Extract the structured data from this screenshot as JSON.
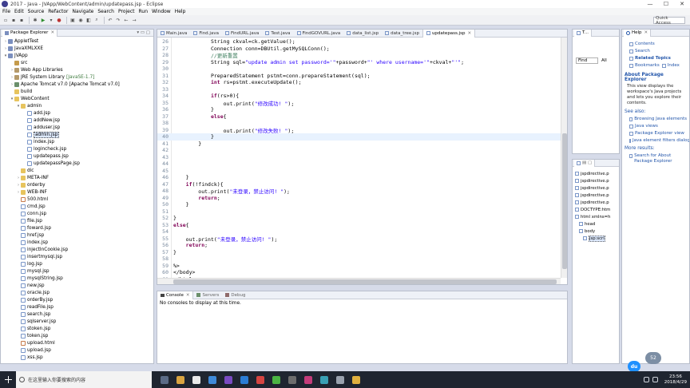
{
  "window": {
    "title": "2017 - Java - JVApp/WebContent/admin/updatepass.jsp - Eclipse",
    "controls": [
      "—",
      "☐",
      "✕"
    ]
  },
  "menu": [
    "File",
    "Edit",
    "Source",
    "Refactor",
    "Navigate",
    "Search",
    "Project",
    "Run",
    "Window",
    "Help"
  ],
  "toolbar": {
    "quick_access": "Quick Access"
  },
  "package_explorer": {
    "tab_label": "Package Explorer",
    "items": [
      {
        "label": "AppletTest",
        "indent": 0,
        "twisty": ">",
        "icon": "proj"
      },
      {
        "label": "JavaXMLXXE",
        "indent": 0,
        "twisty": ">",
        "icon": "proj"
      },
      {
        "label": "JVApp",
        "indent": 0,
        "twisty": "v",
        "icon": "proj"
      },
      {
        "label": "src",
        "indent": 1,
        "twisty": "",
        "icon": "pkg"
      },
      {
        "label": "Web App Libraries",
        "indent": 1,
        "twisty": ">",
        "icon": "lib"
      },
      {
        "label": "JRE System Library",
        "suffix": "[JavaSE-1.7]",
        "indent": 1,
        "twisty": ">",
        "icon": "lib"
      },
      {
        "label": "Apache Tomcat v7.0 [Apache Tomcat v7.0]",
        "indent": 1,
        "twisty": ">",
        "icon": "server"
      },
      {
        "label": "build",
        "indent": 1,
        "twisty": "",
        "icon": "folder"
      },
      {
        "label": "WebContent",
        "indent": 1,
        "twisty": "v",
        "icon": "folder"
      },
      {
        "label": "admin",
        "indent": 2,
        "twisty": "v",
        "icon": "folder"
      },
      {
        "label": "add.jsp",
        "indent": 3,
        "twisty": "",
        "icon": "jsp"
      },
      {
        "label": "addNew.jsp",
        "indent": 3,
        "twisty": "",
        "icon": "jsp"
      },
      {
        "label": "adduser.jsp",
        "indent": 3,
        "twisty": "",
        "icon": "jsp"
      },
      {
        "label": "admin.jsp",
        "indent": 3,
        "twisty": "",
        "icon": "jsp",
        "selected": true
      },
      {
        "label": "index.jsp",
        "indent": 3,
        "twisty": "",
        "icon": "jsp"
      },
      {
        "label": "logincheck.jsp",
        "indent": 3,
        "twisty": "",
        "icon": "jsp"
      },
      {
        "label": "updatepass.jsp",
        "indent": 3,
        "twisty": "",
        "icon": "jsp"
      },
      {
        "label": "updatepassPage.jsp",
        "indent": 3,
        "twisty": "",
        "icon": "jsp"
      },
      {
        "label": "dic",
        "indent": 2,
        "twisty": "",
        "icon": "folder"
      },
      {
        "label": "META-INF",
        "indent": 2,
        "twisty": ">",
        "icon": "folder"
      },
      {
        "label": "orderby",
        "indent": 2,
        "twisty": ">",
        "icon": "folder"
      },
      {
        "label": "WEB-INF",
        "indent": 2,
        "twisty": ">",
        "icon": "folder"
      },
      {
        "label": "500.html",
        "indent": 2,
        "twisty": "",
        "icon": "html"
      },
      {
        "label": "cmd.jsp",
        "indent": 2,
        "twisty": "",
        "icon": "jsp"
      },
      {
        "label": "conn.jsp",
        "indent": 2,
        "twisty": "",
        "icon": "jsp"
      },
      {
        "label": "file.jsp",
        "indent": 2,
        "twisty": "",
        "icon": "jsp"
      },
      {
        "label": "foward.jsp",
        "indent": 2,
        "twisty": "",
        "icon": "jsp"
      },
      {
        "label": "href.jsp",
        "indent": 2,
        "twisty": "",
        "icon": "jsp"
      },
      {
        "label": "index.jsp",
        "indent": 2,
        "twisty": "",
        "icon": "jsp"
      },
      {
        "label": "injectInCookie.jsp",
        "indent": 2,
        "twisty": "",
        "icon": "jsp"
      },
      {
        "label": "insertmysql.jsp",
        "indent": 2,
        "twisty": "",
        "icon": "jsp"
      },
      {
        "label": "log.jsp",
        "indent": 2,
        "twisty": "",
        "icon": "jsp"
      },
      {
        "label": "mysql.jsp",
        "indent": 2,
        "twisty": "",
        "icon": "jsp"
      },
      {
        "label": "mysqlString.jsp",
        "indent": 2,
        "twisty": "",
        "icon": "jsp"
      },
      {
        "label": "new.jsp",
        "indent": 2,
        "twisty": "",
        "icon": "jsp"
      },
      {
        "label": "oracle.jsp",
        "indent": 2,
        "twisty": "",
        "icon": "jsp"
      },
      {
        "label": "orderBy.jsp",
        "indent": 2,
        "twisty": "",
        "icon": "jsp"
      },
      {
        "label": "readFile.jsp",
        "indent": 2,
        "twisty": "",
        "icon": "jsp"
      },
      {
        "label": "search.jsp",
        "indent": 2,
        "twisty": "",
        "icon": "jsp"
      },
      {
        "label": "sqlserver.jsp",
        "indent": 2,
        "twisty": "",
        "icon": "jsp"
      },
      {
        "label": "stoken.jsp",
        "indent": 2,
        "twisty": "",
        "icon": "jsp"
      },
      {
        "label": "token.jsp",
        "indent": 2,
        "twisty": "",
        "icon": "jsp"
      },
      {
        "label": "upload.html",
        "indent": 2,
        "twisty": "",
        "icon": "html"
      },
      {
        "label": "upload.jsp",
        "indent": 2,
        "twisty": "",
        "icon": "jsp"
      },
      {
        "label": "xss.jsp",
        "indent": 2,
        "twisty": "",
        "icon": "jsp"
      }
    ]
  },
  "editor": {
    "tabs": [
      {
        "label": "Main.java",
        "active": false
      },
      {
        "label": "Find.java",
        "active": false
      },
      {
        "label": "FindURL.java",
        "active": false
      },
      {
        "label": "Test.java",
        "active": false
      },
      {
        "label": "FindGOVURL.java",
        "active": false
      },
      {
        "label": "data_list.jsp",
        "active": false
      },
      {
        "label": "data_tree.jsp",
        "active": false
      },
      {
        "label": "updatepass.jsp",
        "active": true
      }
    ],
    "current_line": 40,
    "lines": [
      {
        "n": "26",
        "segs": [
          {
            "t": "            String ckval=ck.getValue();"
          }
        ]
      },
      {
        "n": "27",
        "segs": [
          {
            "t": "            Connection conn=DBUtil.getMySQLConn();"
          }
        ]
      },
      {
        "n": "28",
        "segs": [
          {
            "t": "            //更新重置",
            "c": "cmt"
          }
        ]
      },
      {
        "n": "29",
        "segs": [
          {
            "t": "            String sql="
          },
          {
            "t": "\"update admin set password='\"",
            "c": "str"
          },
          {
            "t": "+password+"
          },
          {
            "t": "\"' where username='\"",
            "c": "str"
          },
          {
            "t": "+ckval+"
          },
          {
            "t": "\"'\"",
            "c": "str"
          },
          {
            "t": ";"
          }
        ]
      },
      {
        "n": "30",
        "segs": [
          {
            "t": ""
          }
        ]
      },
      {
        "n": "31",
        "segs": [
          {
            "t": "            PreparedStatement pstmt=conn.prepareStatement(sql);"
          }
        ]
      },
      {
        "n": "32",
        "segs": [
          {
            "t": "            "
          },
          {
            "t": "int",
            "c": "kw"
          },
          {
            "t": " rs=pstmt.executeUpdate();"
          }
        ]
      },
      {
        "n": "33",
        "segs": [
          {
            "t": ""
          }
        ]
      },
      {
        "n": "34",
        "segs": [
          {
            "t": "            "
          },
          {
            "t": "if",
            "c": "kw"
          },
          {
            "t": "(rs>0){"
          }
        ]
      },
      {
        "n": "35",
        "segs": [
          {
            "t": "                out.print("
          },
          {
            "t": "\"修改成功! \"",
            "c": "str"
          },
          {
            "t": ");"
          }
        ]
      },
      {
        "n": "36",
        "segs": [
          {
            "t": "            }"
          }
        ]
      },
      {
        "n": "37",
        "segs": [
          {
            "t": "            "
          },
          {
            "t": "else",
            "c": "kw"
          },
          {
            "t": "{"
          }
        ]
      },
      {
        "n": "38",
        "segs": [
          {
            "t": ""
          }
        ]
      },
      {
        "n": "39",
        "segs": [
          {
            "t": "                out.print("
          },
          {
            "t": "\"修改失败! \"",
            "c": "str"
          },
          {
            "t": ");"
          }
        ]
      },
      {
        "n": "40",
        "segs": [
          {
            "t": "            }"
          }
        ]
      },
      {
        "n": "41",
        "segs": [
          {
            "t": "        }"
          }
        ]
      },
      {
        "n": "42",
        "segs": [
          {
            "t": ""
          }
        ]
      },
      {
        "n": "43",
        "segs": [
          {
            "t": ""
          }
        ]
      },
      {
        "n": "44",
        "segs": [
          {
            "t": ""
          }
        ]
      },
      {
        "n": "45",
        "segs": [
          {
            "t": ""
          }
        ]
      },
      {
        "n": "46",
        "segs": [
          {
            "t": "    }"
          }
        ]
      },
      {
        "n": "47",
        "segs": [
          {
            "t": "    "
          },
          {
            "t": "if",
            "c": "kw"
          },
          {
            "t": "(!findck){"
          }
        ]
      },
      {
        "n": "48",
        "segs": [
          {
            "t": "        out.print("
          },
          {
            "t": "\"未登录，禁止访问! \"",
            "c": "str"
          },
          {
            "t": ");"
          }
        ]
      },
      {
        "n": "49",
        "segs": [
          {
            "t": "        "
          },
          {
            "t": "return",
            "c": "kw"
          },
          {
            "t": ";"
          }
        ]
      },
      {
        "n": "50",
        "segs": [
          {
            "t": "    }"
          }
        ]
      },
      {
        "n": "51",
        "segs": [
          {
            "t": ""
          }
        ]
      },
      {
        "n": "52",
        "segs": [
          {
            "t": "}"
          }
        ]
      },
      {
        "n": "53",
        "segs": [
          {
            "t": ""
          },
          {
            "t": "else",
            "c": "kw"
          },
          {
            "t": "{"
          }
        ]
      },
      {
        "n": "54",
        "segs": [
          {
            "t": ""
          }
        ]
      },
      {
        "n": "55",
        "segs": [
          {
            "t": "    out.print("
          },
          {
            "t": "\"未登录，禁止访问! \"",
            "c": "str"
          },
          {
            "t": ");"
          }
        ]
      },
      {
        "n": "56",
        "segs": [
          {
            "t": "    "
          },
          {
            "t": "return",
            "c": "kw"
          },
          {
            "t": ";"
          }
        ]
      },
      {
        "n": "57",
        "segs": [
          {
            "t": "}"
          }
        ]
      },
      {
        "n": "58",
        "segs": [
          {
            "t": ""
          }
        ]
      },
      {
        "n": "59",
        "segs": [
          {
            "t": "%>"
          }
        ]
      },
      {
        "n": "60",
        "segs": [
          {
            "t": "</body>"
          }
        ]
      },
      {
        "n": "61",
        "segs": [
          {
            "t": "</html>"
          }
        ]
      }
    ]
  },
  "console": {
    "tabs": [
      "Console",
      "Servers",
      "Debug"
    ],
    "message": "No consoles to display at this time."
  },
  "outline_top": {
    "tab_label": "T...",
    "find_label": "Find",
    "find_scope": "All"
  },
  "outline_bottom": {
    "items": [
      {
        "label": "jspdirective.p",
        "indent": 0
      },
      {
        "label": "jspdirective.p",
        "indent": 0
      },
      {
        "label": "jspdirective.p",
        "indent": 0
      },
      {
        "label": "jspdirective.p",
        "indent": 0
      },
      {
        "label": "jspdirective.p",
        "indent": 0
      },
      {
        "label": "DOCTYPE:htm",
        "indent": 0
      },
      {
        "label": "html xmlns=h",
        "indent": 0
      },
      {
        "label": "head",
        "indent": 1
      },
      {
        "label": "body",
        "indent": 1
      },
      {
        "label": "jsp:scri",
        "indent": 2,
        "selected": true
      }
    ]
  },
  "help": {
    "tab_label": "Help",
    "links": [
      "Contents",
      "Search"
    ],
    "related_topics": "Related Topics",
    "bookmarks": "Bookmarks",
    "index": "Index",
    "about_title": "About Package Explorer",
    "about_text": "This view displays the workspace's Java projects and lets you explore their contents.",
    "see_also": "See also:",
    "see_links": [
      "Browsing Java elements",
      "Java views",
      "Package Explorer view",
      "Java element filters dialog"
    ],
    "more_results": "More results:",
    "search_about": "Search for About Package Explorer"
  },
  "overlay": {
    "badge": "52",
    "du": "du"
  },
  "taskbar": {
    "search_placeholder": "在这里输入你要搜索的内容",
    "time": "23:56",
    "date": "2018/4/29",
    "task_colors": [
      "#5b6b86",
      "#d9a441",
      "#e9e9e9",
      "#3f8ad9",
      "#7a4bc2",
      "#2c7dd4",
      "#d64541",
      "#4bb543",
      "#6d6d6d",
      "#c43c7a",
      "#3aa0b4",
      "#9aa2ae",
      "#e0b03e"
    ]
  }
}
